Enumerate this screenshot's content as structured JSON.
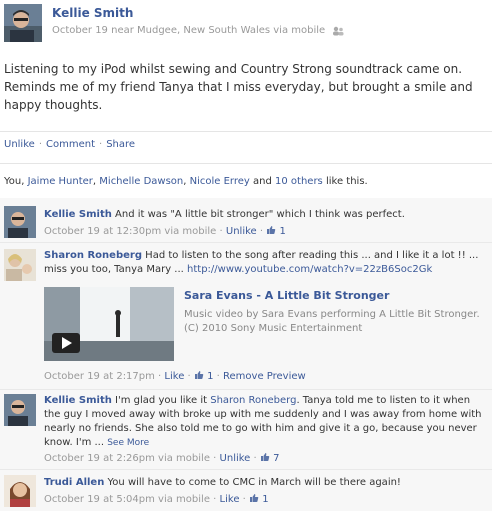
{
  "post": {
    "author": "Kellie Smith",
    "meta": "October 19 near Mudgee, New South Wales via mobile",
    "audience_icon": "people-icon",
    "text": "Listening to my iPod whilst sewing and Country Strong soundtrack came on. Reminds me of my friend Tanya that I miss everyday, but brought a smile and happy thoughts."
  },
  "actions": {
    "unlike": "Unlike",
    "comment": "Comment",
    "share": "Share"
  },
  "likes": {
    "prefix": "You,",
    "people": [
      "Jaime Hunter",
      "Michelle Dawson",
      "Nicole Errey"
    ],
    "and": "and",
    "others": "10 others",
    "suffix": "like this."
  },
  "comments": [
    {
      "author": "Kellie Smith",
      "text": "And it was \"A little bit stronger\" which I think was perfect.",
      "time": "October 19 at 12:30pm via mobile",
      "action": "Unlike",
      "likes": "1"
    },
    {
      "author": "Sharon Roneberg",
      "text": "Had to listen to the song after reading this ... and I like it a lot !! ... miss you too, Tanya Mary ...",
      "link": "http://www.youtube.com/watch?v=22zB6Soc2Gk",
      "time": "October 19 at 2:17pm",
      "action": "Like",
      "likes": "1",
      "extra_action": "Remove Preview",
      "video": {
        "title": "Sara Evans - A Little Bit Stronger",
        "description": "Music video by Sara Evans performing A Little Bit Stronger. (C) 2010 Sony Music Entertainment"
      }
    },
    {
      "author": "Kellie Smith",
      "text_before": "I'm glad you like it",
      "mention": "Sharon Roneberg",
      "text_after": ". Tanya told me to listen to it when the guy I moved away with broke up with me suddenly and I was away from home with nearly no friends. She also told me to go with him and give it a go, because you never know. I'm ...",
      "see_more": "See More",
      "time": "October 19 at 2:26pm via mobile",
      "action": "Unlike",
      "likes": "7"
    },
    {
      "author": "Trudi Allen",
      "text": "You will have to come to CMC in March will be there again!",
      "time": "October 19 at 5:04pm via mobile",
      "action": "Like",
      "likes": "1"
    }
  ],
  "colors": {
    "link": "#3b5998",
    "meta": "#999999",
    "comment_bg": "#f7f7f7"
  }
}
